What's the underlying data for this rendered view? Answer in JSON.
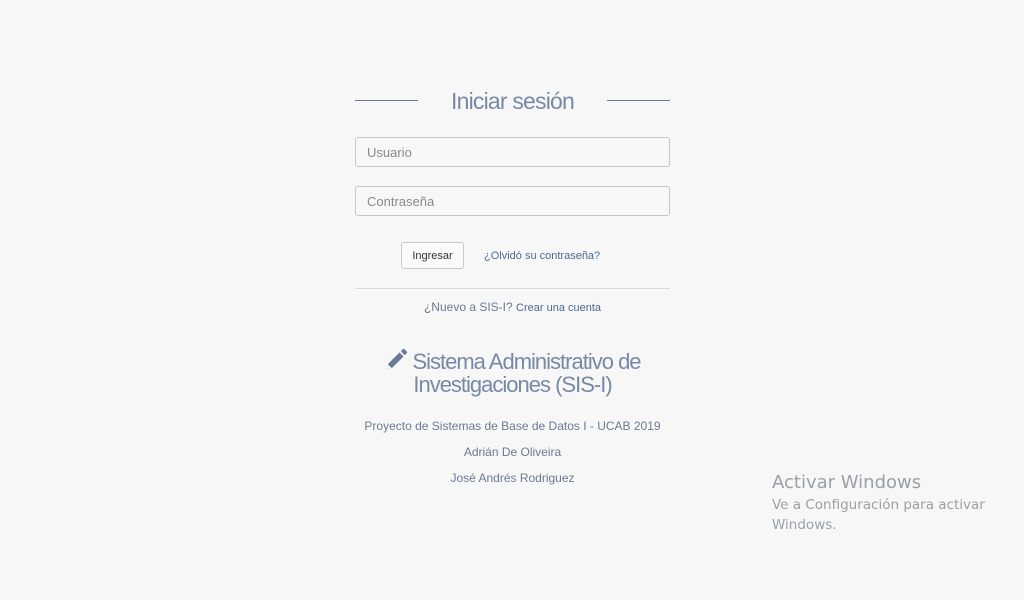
{
  "login": {
    "title": "Iniciar sesión",
    "username_placeholder": "Usuario",
    "username_value": "",
    "password_placeholder": "Contraseña",
    "password_value": "",
    "submit_label": "Ingresar",
    "forgot_label": "¿Olvidó su contraseña?",
    "signup_prompt": "¿Nuevo a SIS-I?",
    "signup_link": "Crear una cuenta"
  },
  "brand": {
    "icon": "pencil-icon",
    "line1": "Sistema Administrativo de",
    "line2": "Investigaciones (SIS-I)"
  },
  "credits": {
    "project": "Proyecto de Sistemas de Base de Datos I - UCAB 2019",
    "author1": "Adrián De Oliveira",
    "author2": "José Andrés Rodriguez"
  },
  "os_watermark": {
    "title": "Activar Windows",
    "subtitle": "Ve a Configuración para activar Windows."
  },
  "colors": {
    "background": "#f7f7f7",
    "text": "#6b7a94",
    "link": "#4d6a91"
  }
}
